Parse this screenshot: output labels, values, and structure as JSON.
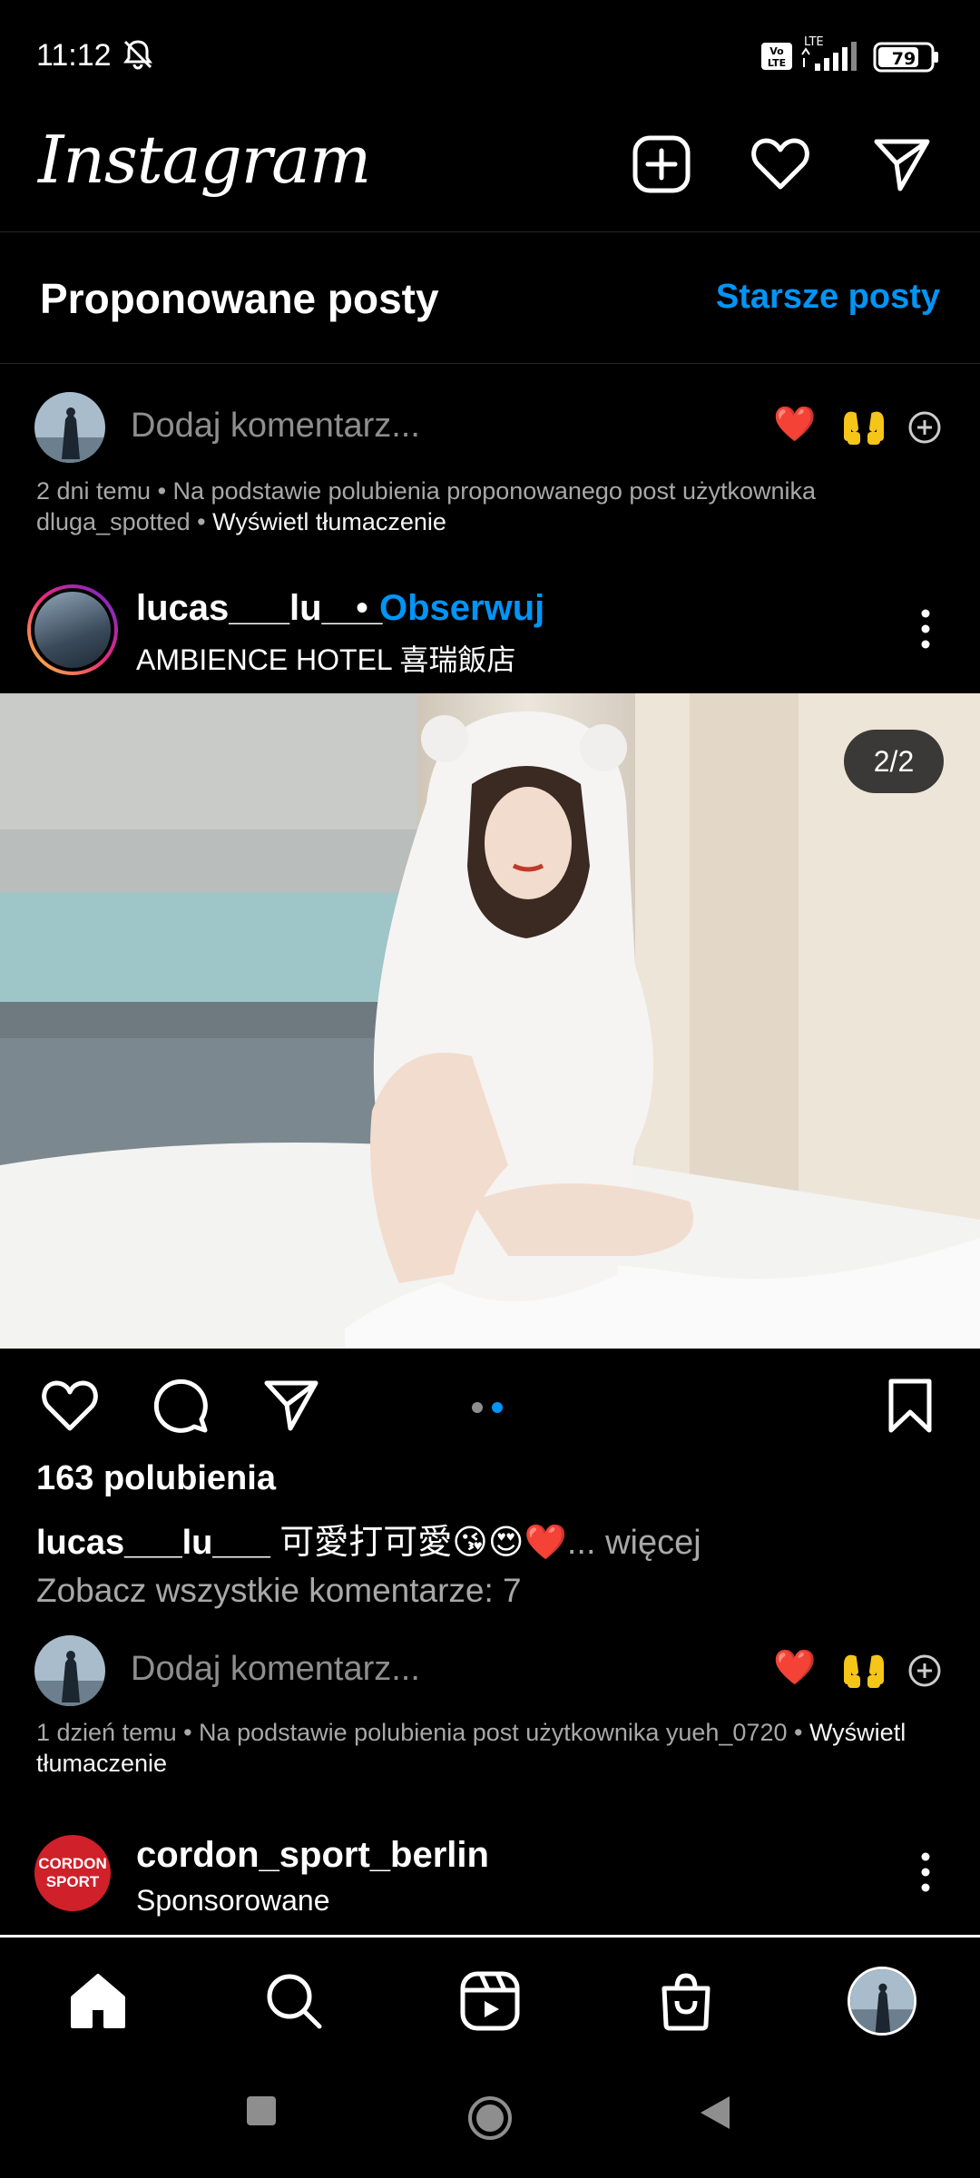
{
  "status": {
    "time": "11:12",
    "network": "LTE",
    "battery": "79"
  },
  "header": {
    "logo": "Instagram"
  },
  "suggested": {
    "title": "Proponowane posty",
    "older_link": "Starsze posty"
  },
  "comment_box_1": {
    "placeholder": "Dodaj komentarz...",
    "emoji_heart": "❤️",
    "emoji_hands": "🙌"
  },
  "meta_1": {
    "text": "2 dni temu • Na podstawie polubienia proponowanego post użytkownika dluga_spotted • ",
    "translate": "Wyświetl tłumaczenie"
  },
  "post": {
    "username": "lucas___lu___",
    "separator": "•",
    "follow": "Obserwuj",
    "location": "AMBIENCE HOTEL 喜瑞飯店",
    "counter": "2/2",
    "carousel": {
      "total": 2,
      "current": 2
    },
    "likes": "163 polubienia",
    "caption_user": "lucas___lu___",
    "caption_text": " 可愛打可愛😘😍❤️",
    "caption_more": "... więcej",
    "view_all": "Zobacz wszystkie komentarze: 7"
  },
  "comment_box_2": {
    "placeholder": "Dodaj komentarz...",
    "emoji_heart": "❤️",
    "emoji_hands": "🙌"
  },
  "meta_2": {
    "text": "1 dzień temu • Na podstawie polubienia post użytkownika yueh_0720 • ",
    "translate": "Wyświetl tłumaczenie"
  },
  "sponsored": {
    "logo_text": "CORDON SPORT",
    "username": "cordon_sport_berlin",
    "label": "Sponsorowane"
  },
  "colors": {
    "accent": "#0095f6",
    "background": "#000000",
    "secondary_text": "#a8a8a8"
  }
}
